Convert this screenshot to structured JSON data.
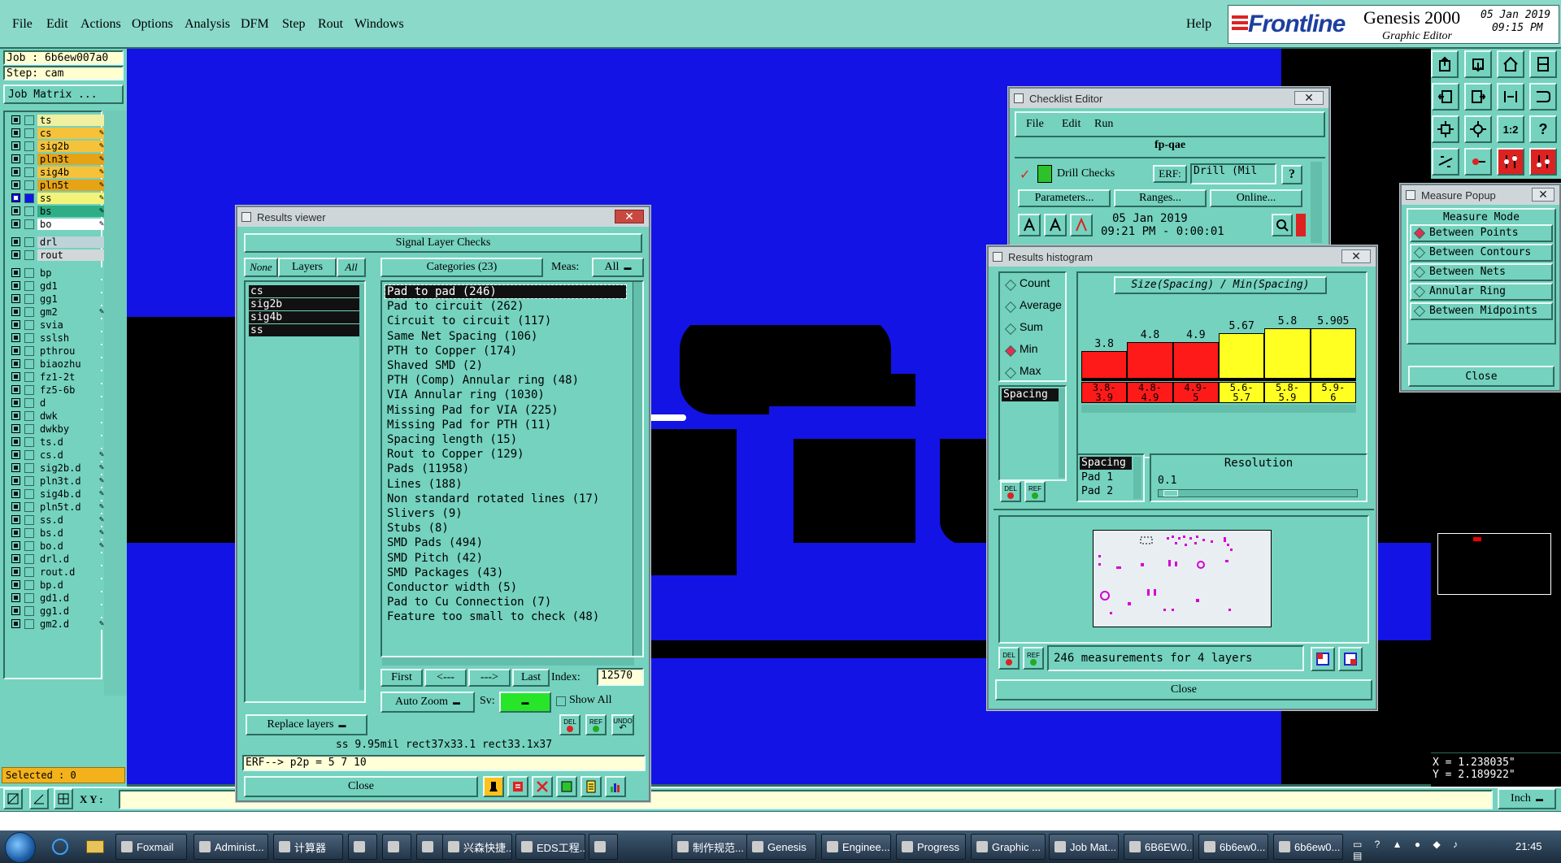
{
  "menubar": {
    "items": [
      "File",
      "Edit",
      "Actions",
      "Options",
      "Analysis",
      "DFM",
      "Step",
      "Rout",
      "Windows"
    ],
    "help": "Help",
    "brand": "Frontline",
    "product": "Genesis 2000",
    "subtitle": "Graphic Editor",
    "date": "05 Jan 2019",
    "time": "09:15 PM"
  },
  "job": {
    "job": "Job : 6b6ew007a0",
    "step": "Step: cam",
    "matrix_btn": "Job Matrix ..."
  },
  "layers": [
    {
      "name": "ts",
      "color": "#f0f0a0",
      "selected": false
    },
    {
      "name": "cs",
      "color": "#f6c23a",
      "mark": true
    },
    {
      "name": "sig2b",
      "color": "#f6c23a",
      "mark": true
    },
    {
      "name": "pln3t",
      "color": "#e6a316",
      "mark": true
    },
    {
      "name": "sig4b",
      "color": "#f6c23a",
      "mark": true
    },
    {
      "name": "pln5t",
      "color": "#e6a316",
      "mark": true
    },
    {
      "name": "ss",
      "color": "#f3f37a",
      "mark": true,
      "active": true
    },
    {
      "name": "bs",
      "color": "#2fae86",
      "mark": true
    },
    {
      "name": "bo",
      "color": "#ffffff",
      "mark": true
    },
    {
      "name": "drl",
      "color": "#bdd3d8",
      "gap": true
    },
    {
      "name": "rout",
      "color": "#d2d8da"
    },
    {
      "name": "bp",
      "color": "#74d2be",
      "gap": true
    },
    {
      "name": "gd1",
      "color": "#74d2be"
    },
    {
      "name": "gg1",
      "color": "#74d2be"
    },
    {
      "name": "gm2",
      "color": "#74d2be",
      "mark": true
    },
    {
      "name": "svia",
      "color": "#74d2be"
    },
    {
      "name": "sslsh",
      "color": "#74d2be"
    },
    {
      "name": "pthrou",
      "color": "#74d2be"
    },
    {
      "name": "biaozhu",
      "color": "#74d2be"
    },
    {
      "name": "fz1-2t",
      "color": "#74d2be"
    },
    {
      "name": "fz5-6b",
      "color": "#74d2be"
    },
    {
      "name": "d",
      "color": "#74d2be"
    },
    {
      "name": "dwk",
      "color": "#74d2be"
    },
    {
      "name": "dwkby",
      "color": "#74d2be"
    },
    {
      "name": "ts.d",
      "color": "#74d2be"
    },
    {
      "name": "cs.d",
      "color": "#74d2be",
      "mark": true
    },
    {
      "name": "sig2b.d",
      "color": "#74d2be",
      "mark": true
    },
    {
      "name": "pln3t.d",
      "color": "#74d2be",
      "mark": true
    },
    {
      "name": "sig4b.d",
      "color": "#74d2be",
      "mark": true
    },
    {
      "name": "pln5t.d",
      "color": "#74d2be",
      "mark": true
    },
    {
      "name": "ss.d",
      "color": "#74d2be",
      "mark": true
    },
    {
      "name": "bs.d",
      "color": "#74d2be",
      "mark": true
    },
    {
      "name": "bo.d",
      "color": "#74d2be",
      "mark": true
    },
    {
      "name": "drl.d",
      "color": "#74d2be"
    },
    {
      "name": "rout.d",
      "color": "#74d2be"
    },
    {
      "name": "bp.d",
      "color": "#74d2be"
    },
    {
      "name": "gd1.d",
      "color": "#74d2be"
    },
    {
      "name": "gg1.d",
      "color": "#74d2be"
    },
    {
      "name": "gm2.d",
      "color": "#74d2be",
      "mark": true
    }
  ],
  "selected_label": "Selected : 0",
  "coord_bar": {
    "label": "X Y :",
    "units": "Inch"
  },
  "results_viewer": {
    "title": "Results viewer",
    "header": "Signal Layer Checks",
    "none_btn": "None",
    "layers_btn": "Layers",
    "all_btn": "All",
    "categories_btn": "Categories (23)",
    "meas_label": "Meas:",
    "meas_value": "All",
    "layers": [
      "cs",
      "sig2b",
      "sig4b",
      "ss"
    ],
    "categories": [
      "Pad to pad (246)",
      "Pad to circuit (262)",
      "Circuit to circuit (117)",
      "Same Net Spacing (106)",
      "PTH to Copper (174)",
      "Shaved SMD (2)",
      "PTH (Comp) Annular ring (48)",
      "VIA Annular ring (1030)",
      "Missing Pad for VIA (225)",
      "Missing Pad for PTH (11)",
      "Spacing length (15)",
      "Rout to Copper (129)",
      "Pads (11958)",
      "Lines (188)",
      "Non standard rotated lines (17)",
      "Slivers (9)",
      "Stubs (8)",
      "SMD Pads (494)",
      "SMD Pitch (42)",
      "SMD Packages (43)",
      "Conductor width (5)",
      "Pad to Cu Connection (7)",
      "Feature too small to check (48)"
    ],
    "first": "First",
    "prev": "<---",
    "next": "--->",
    "last": "Last",
    "index_label": "Index:",
    "index_value": "12570",
    "auto_zoom": "Auto Zoom",
    "sv_label": "Sv:",
    "show_all": "Show All",
    "replace_layers": "Replace layers",
    "del": "DEL",
    "ref": "REF",
    "undo": "UNDO",
    "info": "ss 9.95mil   rect37x33.1   rect33.1x37",
    "erf": "ERF--> p2p = 5 7 10",
    "close": "Close"
  },
  "checklist": {
    "title": "Checklist Editor",
    "menu": [
      "File",
      "Edit",
      "Run"
    ],
    "name": "fp-qae",
    "check": "Drill Checks",
    "erf_label": "ERF:",
    "erf_value": "Drill (Mil",
    "help": "?",
    "buttons": [
      "Parameters...",
      "Ranges...",
      "Online..."
    ],
    "date": "05 Jan 2019",
    "time": "09:21 PM - 0:00:01"
  },
  "histogram": {
    "title": "Results histogram",
    "options": [
      "Count",
      "Average",
      "Sum",
      "Min",
      "Max"
    ],
    "selected_option": "Min",
    "list_item": "Spacing",
    "chart_title": "Size(Spacing) / Min(Spacing)",
    "bars": [
      {
        "value": "3.8",
        "range": "3.8-\n3.9",
        "color": "#ff1a1a",
        "level": 0.4
      },
      {
        "value": "4.8",
        "range": "4.8-\n4.9",
        "color": "#ff1a1a",
        "level": 0.52
      },
      {
        "value": "4.9",
        "range": "4.9-\n5",
        "color": "#ff1a1a",
        "level": 0.52
      },
      {
        "value": "5.67",
        "range": "5.6-\n5.7",
        "color": "#ffff22",
        "level": 0.65
      },
      {
        "value": "5.8",
        "range": "5.8-\n5.9",
        "color": "#ffff22",
        "level": 0.72
      },
      {
        "value": "5.905",
        "range": "5.9-\n6",
        "color": "#ffff22",
        "level": 0.72
      }
    ],
    "detail": [
      "Spacing",
      "Pad 1",
      "Pad 2"
    ],
    "resolution_label": "Resolution",
    "resolution_value": "0.1",
    "measurements": "246 measurements for 4 layers",
    "close": "Close",
    "del": "DEL",
    "ref": "REF"
  },
  "measure": {
    "title": "Measure Popup",
    "mode_label": "Measure Mode",
    "modes": [
      "Between Points",
      "Between Contours",
      "Between Nets",
      "Annular Ring",
      "Between Midpoints"
    ],
    "selected": "Between Points",
    "close": "Close"
  },
  "readout": {
    "x": "X = 1.238035\"",
    "y": "Y = 2.189922\""
  },
  "taskbar": {
    "items": [
      "Foxmail",
      "Administ...",
      "计算器",
      "",
      "",
      "",
      "兴森快捷...",
      "EDS工程...",
      "",
      "制作规范...",
      "Genesis",
      "Enginee...",
      "Progress",
      "Graphic ...",
      "Job Mat...",
      "6B6EW0...",
      "6b6ew0...",
      "6b6ew0..."
    ],
    "clock": "21:45"
  }
}
